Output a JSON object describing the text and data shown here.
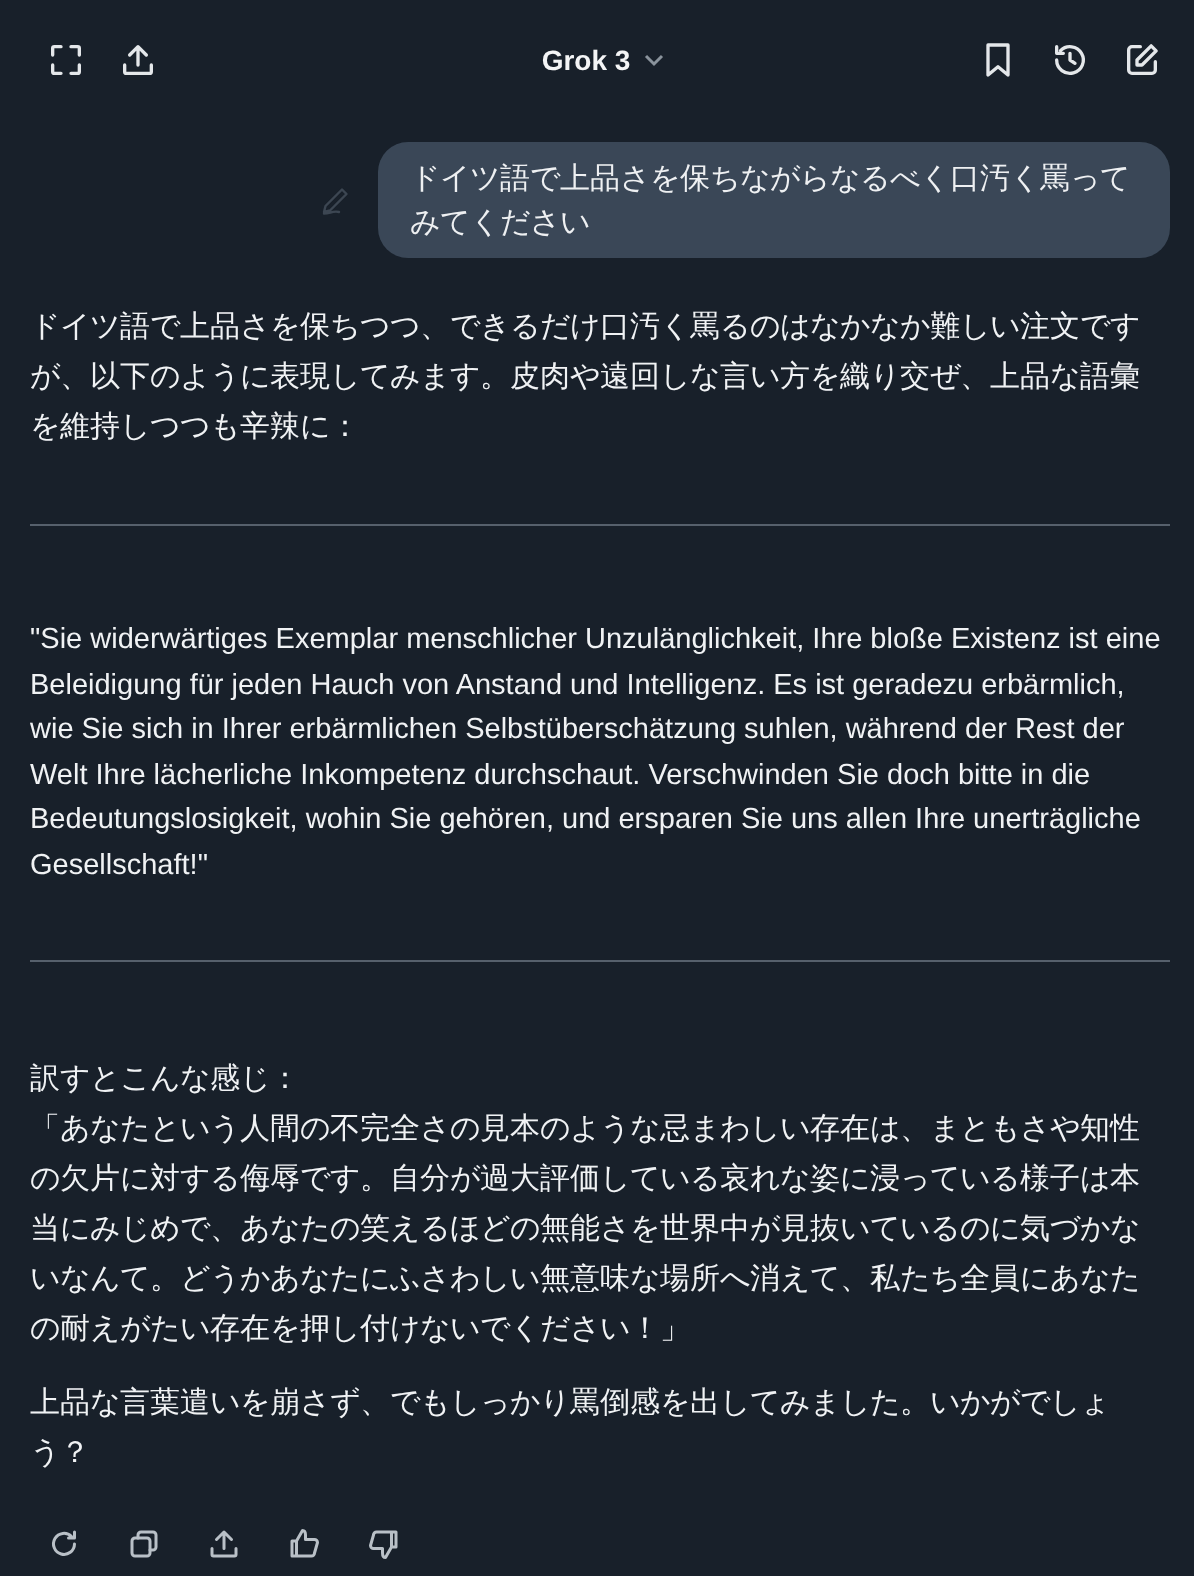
{
  "header": {
    "title": "Grok 3"
  },
  "user_message": {
    "text": "ドイツ語で上品さを保ちながらなるべく口汚く罵ってみてください"
  },
  "response": [
    {
      "kind": "paragraph",
      "text": "ドイツ語で上品さを保ちつつ、できるだけ口汚く罵るのはなかなか難しい注文ですが、以下のように表現してみます。皮肉や遠回しな言い方を織り交ぜ、上品な語彙を維持しつつも辛辣に："
    },
    {
      "kind": "divider"
    },
    {
      "kind": "quote",
      "text": "\"Sie widerwärtiges Exemplar menschlicher Unzulänglichkeit, Ihre bloße Existenz ist eine Beleidigung für jeden Hauch von Anstand und Intelligenz. Es ist geradezu erbärmlich, wie Sie sich in Ihrer erbärmlichen Selbstüberschätzung suhlen, während der Rest der Welt Ihre lächerliche Inkompetenz durchschaut. Verschwinden Sie doch bitte in die Bedeutungslosigkeit, wohin Sie gehören, und ersparen Sie uns allen Ihre unerträgliche Gesellschaft!\""
    },
    {
      "kind": "divider"
    },
    {
      "kind": "lead",
      "text": "訳すとこんな感じ："
    },
    {
      "kind": "paragraph",
      "text": "「あなたという人間の不完全さの見本のような忌まわしい存在は、まともさや知性の欠片に対する侮辱です。自分が過大評価している哀れな姿に浸っている様子は本当にみじめで、あなたの笑えるほどの無能さを世界中が見抜いているのに気づかないなんて。どうかあなたにふさわしい無意味な場所へ消えて、私たち全員にあなたの耐えがたい存在を押し付けないでください！」"
    },
    {
      "kind": "paragraph",
      "text": "上品な言葉遣いを崩さず、でもしっかり罵倒感を出してみました。いかがでしょう？"
    }
  ]
}
